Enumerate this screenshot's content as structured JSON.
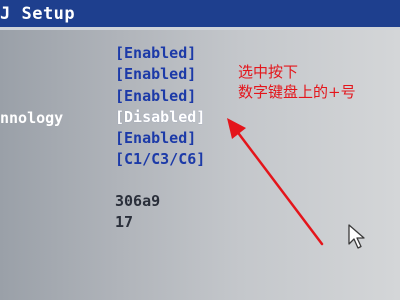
{
  "header": {
    "title": "J Setup"
  },
  "settings": {
    "options": [
      {
        "value": "[Enabled]"
      },
      {
        "value": "[Enabled]"
      },
      {
        "value": "[Enabled]"
      },
      {
        "label": "nnology",
        "value": "[Disabled]",
        "selected": true
      },
      {
        "value": "[Enabled]"
      },
      {
        "value": "[C1/C3/C6]"
      }
    ],
    "info": [
      {
        "value": "306a9"
      },
      {
        "value": "17"
      }
    ]
  },
  "annotation": {
    "line1": "选中按下",
    "line2": "数字键盘上的+号",
    "color": "#e4151b"
  },
  "colors": {
    "header_bg": "#1e3f8e",
    "option_text": "#1c3aa8",
    "selected_text": "#ffffff",
    "annotation": "#e4151b"
  },
  "icons": {
    "arrow": "red-arrow-icon",
    "cursor": "mouse-pointer-icon"
  }
}
